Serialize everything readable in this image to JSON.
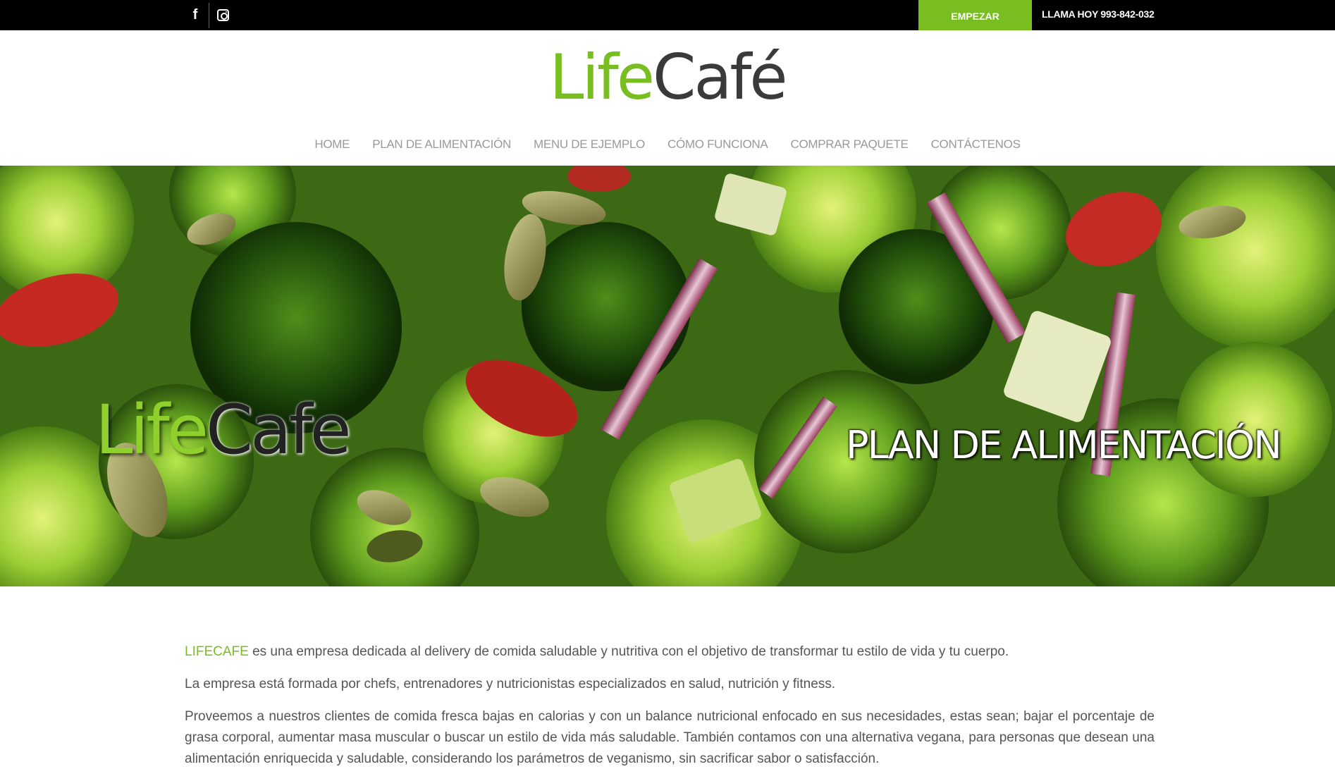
{
  "topbar": {
    "social": [
      {
        "icon": "facebook-icon",
        "glyph": "f"
      },
      {
        "icon": "instagram-icon"
      }
    ],
    "cta_label": "EMPEZAR",
    "phone_label": "LLAMA HOY 993-842-032"
  },
  "logo": {
    "life": "Life",
    "cafe": "Café"
  },
  "nav": {
    "items": [
      {
        "label": "HOME"
      },
      {
        "label": "PLAN DE ALIMENTACIÓN"
      },
      {
        "label": "MENU DE EJEMPLO"
      },
      {
        "label": "CÓMO FUNCIONA"
      },
      {
        "label": "COMPRAR PAQUETE"
      },
      {
        "label": "CONTÁCTENOS"
      }
    ]
  },
  "hero": {
    "brand_life": "Life",
    "brand_cafe": "Cafe",
    "title": "PLAN DE ALIMENTACIÓN"
  },
  "content": {
    "p1_brand": "LIFECAFE",
    "p1_rest": " es una empresa dedicada al delivery de comida saludable y nutritiva con el objetivo de transformar tu estilo de vida y tu cuerpo.",
    "p2": "La empresa está formada por chefs, entrenadores y nutricionistas especializados en salud, nutrición y fitness.",
    "p3": "Proveemos a nuestros clientes de comida fresca bajas en calorias y con un balance nutricional enfocado en sus necesidades, estas sean; bajar el porcentaje de grasa corporal, aumentar masa muscular o buscar un estilo de vida más saludable. También contamos con una alternativa vegana, para personas que desean una alimentación enriquecida y saludable, considerando los parámetros de veganismo, sin sacrificar sabor o satisfacción."
  },
  "colors": {
    "accent": "#78be20",
    "topbar": "#000000",
    "nav_text": "#999999",
    "body_text": "#555555"
  }
}
